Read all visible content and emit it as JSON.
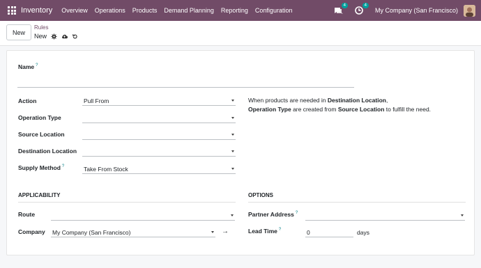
{
  "navbar": {
    "app_name": "Inventory",
    "menu": [
      "Overview",
      "Operations",
      "Products",
      "Demand Planning",
      "Reporting",
      "Configuration"
    ],
    "messages_count": "4",
    "activities_count": "4",
    "company": "My Company (San Francisco)",
    "color": "#714b67"
  },
  "control": {
    "new_label": "New",
    "breadcrumb_parent": "Rules",
    "breadcrumb_current": "New"
  },
  "form": {
    "name_label": "Name",
    "name_help": "?",
    "name_value": "",
    "action_label": "Action",
    "action_value": "Pull From",
    "operation_type_label": "Operation Type",
    "operation_type_value": "",
    "source_location_label": "Source Location",
    "source_location_value": "",
    "destination_location_label": "Destination Location",
    "destination_location_value": "",
    "supply_method_label": "Supply Method",
    "supply_method_help": "?",
    "supply_method_value": "Take From Stock",
    "description": {
      "p1": "When products are needed in ",
      "b1": "Destination Location",
      "p2": ",",
      "b2": "Operation Type",
      "p3": " are created from ",
      "b3": "Source Location",
      "p4": " to fulfill the need."
    },
    "applicability_title": "APPLICABILITY",
    "route_label": "Route",
    "route_value": "",
    "company_label": "Company",
    "company_value": "My Company (San Francisco)",
    "options_title": "OPTIONS",
    "partner_address_label": "Partner Address",
    "partner_address_help": "?",
    "partner_address_value": "",
    "lead_time_label": "Lead Time",
    "lead_time_help": "?",
    "lead_time_value": "0",
    "lead_time_unit": "days"
  }
}
